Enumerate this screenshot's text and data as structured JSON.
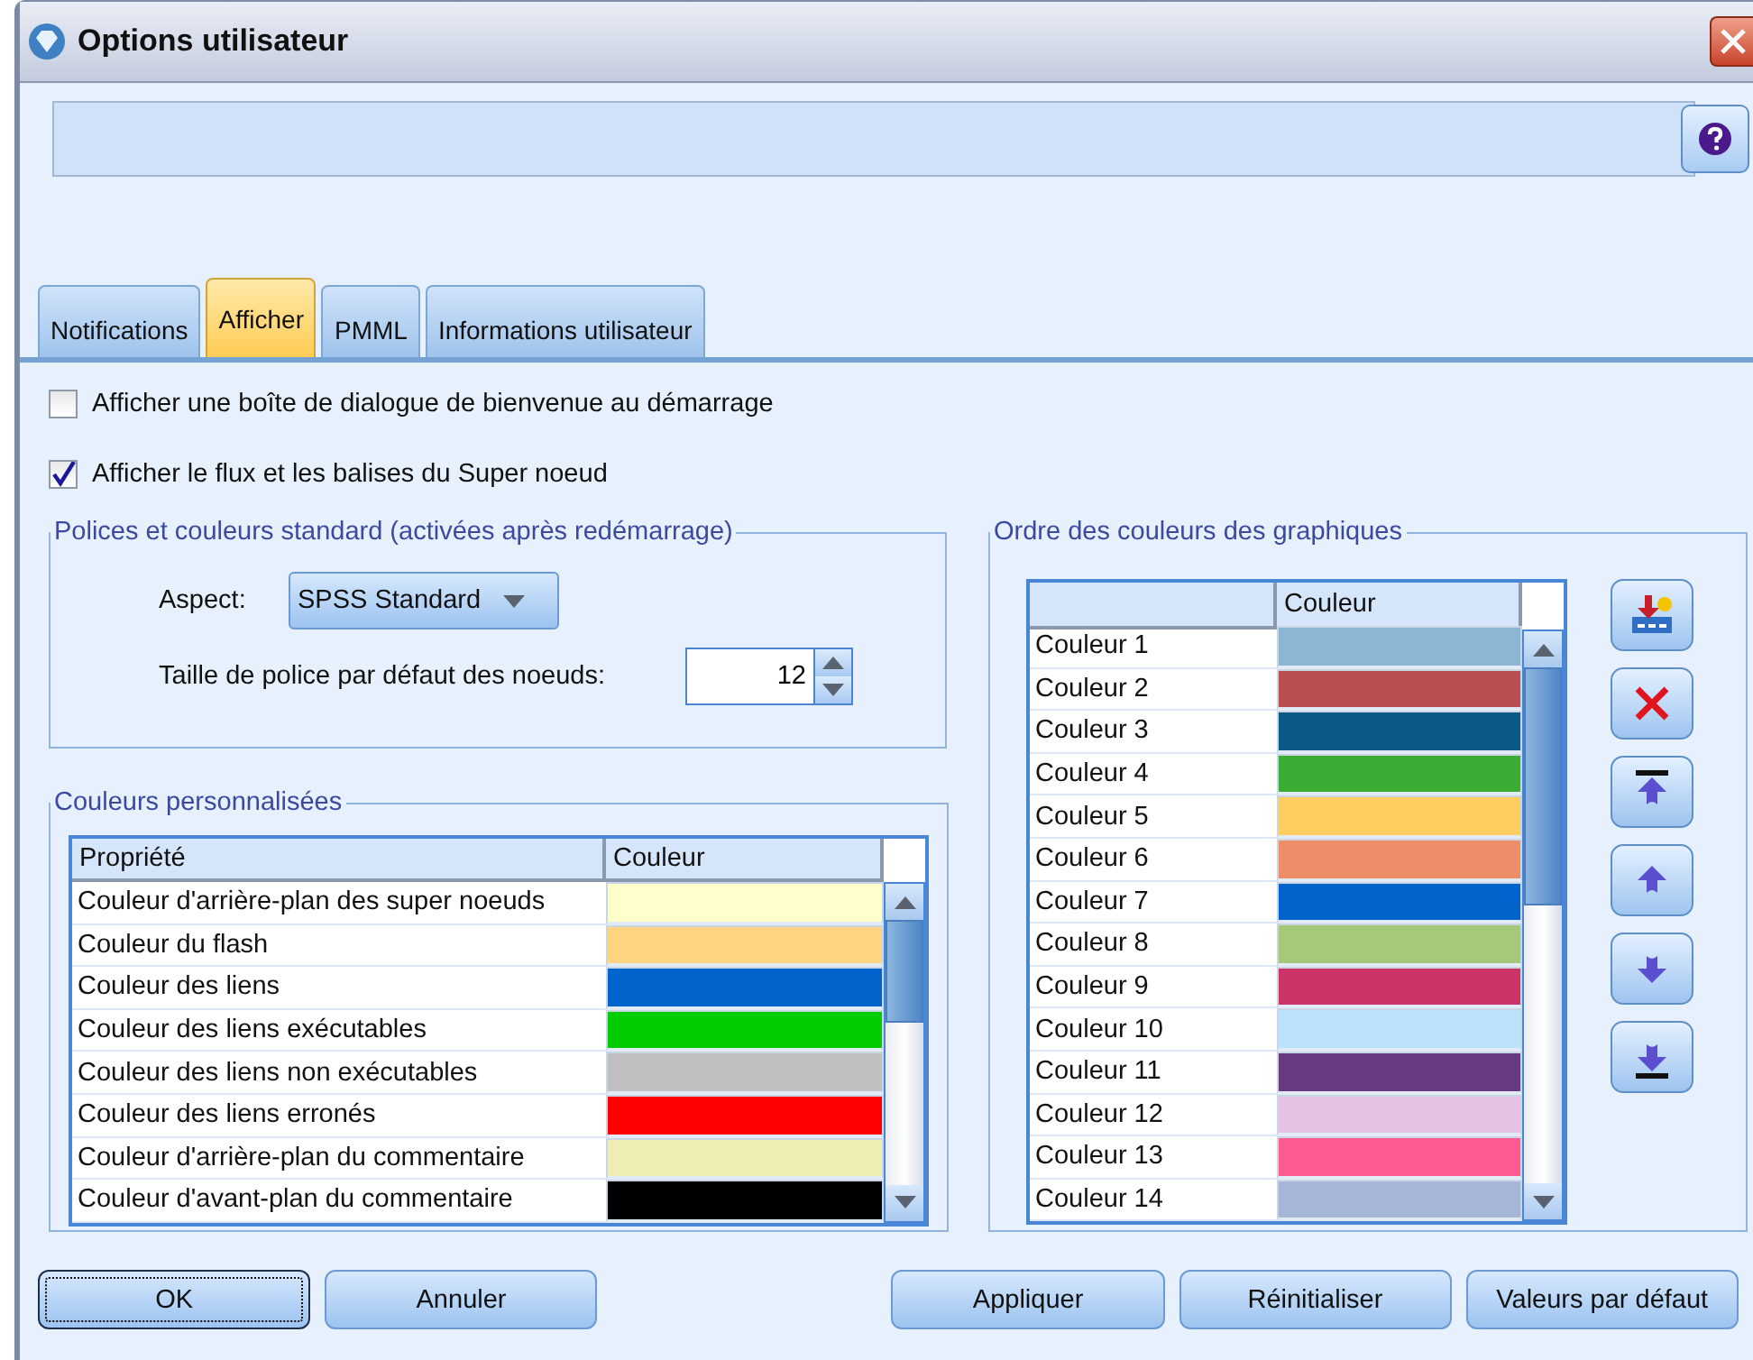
{
  "window": {
    "title": "Options utilisateur"
  },
  "tabs": [
    {
      "label": "Notifications",
      "selected": false
    },
    {
      "label": "Afficher",
      "selected": true
    },
    {
      "label": "PMML",
      "selected": false
    },
    {
      "label": "Informations utilisateur",
      "selected": false
    }
  ],
  "options": [
    {
      "label": "Afficher une boîte de dialogue de bienvenue au démarrage",
      "checked": false
    },
    {
      "label": "Afficher le flux et les balises du Super noeud",
      "checked": true
    }
  ],
  "fonts_group": {
    "title": "Polices et couleurs standard (activées après redémarrage)",
    "aspect": {
      "label": "Aspect:",
      "value": "SPSS Standard"
    },
    "font_size": {
      "label": "Taille de police par défaut des noeuds:",
      "value": "12"
    }
  },
  "custom_colors": {
    "title": "Couleurs personnalisées",
    "columns": [
      "Propriété",
      "Couleur"
    ],
    "rows": [
      {
        "property": "Couleur d'arrière-plan des super noeuds",
        "color": "#ffffcc"
      },
      {
        "property": "Couleur du flash",
        "color": "#fdd581"
      },
      {
        "property": "Couleur des liens",
        "color": "#0064cc"
      },
      {
        "property": "Couleur des liens exécutables",
        "color": "#00cc00"
      },
      {
        "property": "Couleur des liens non exécutables",
        "color": "#c0c0c0"
      },
      {
        "property": "Couleur des liens erronés",
        "color": "#ff0000"
      },
      {
        "property": "Couleur d'arrière-plan du commentaire",
        "color": "#eeeeb4"
      },
      {
        "property": "Couleur d'avant-plan du commentaire",
        "color": "#000000"
      }
    ]
  },
  "chart_colors": {
    "title": "Ordre des couleurs des graphiques",
    "color_column": "Couleur",
    "rows": [
      {
        "name": "Couleur 1",
        "color": "#8cb6d4"
      },
      {
        "name": "Couleur 2",
        "color": "#b94d52"
      },
      {
        "name": "Couleur 3",
        "color": "#0a5788"
      },
      {
        "name": "Couleur 4",
        "color": "#3aac33"
      },
      {
        "name": "Couleur 5",
        "color": "#fecd5f"
      },
      {
        "name": "Couleur 6",
        "color": "#ed8e69"
      },
      {
        "name": "Couleur 7",
        "color": "#0064cc"
      },
      {
        "name": "Couleur 8",
        "color": "#a6c979"
      },
      {
        "name": "Couleur 9",
        "color": "#cc3366"
      },
      {
        "name": "Couleur 10",
        "color": "#bde3fc"
      },
      {
        "name": "Couleur 11",
        "color": "#6a3a80"
      },
      {
        "name": "Couleur 12",
        "color": "#e5c2e4"
      },
      {
        "name": "Couleur 13",
        "color": "#fd5a91"
      },
      {
        "name": "Couleur 14",
        "color": "#a6b6d6"
      }
    ]
  },
  "buttons": {
    "left": [
      {
        "label": "OK",
        "focused": true
      },
      {
        "label": "Annuler",
        "focused": false
      }
    ],
    "right": [
      {
        "label": "Appliquer",
        "focused": false
      },
      {
        "label": "Réinitialiser",
        "focused": false
      },
      {
        "label": "Valeurs par défaut",
        "focused": false
      }
    ]
  }
}
